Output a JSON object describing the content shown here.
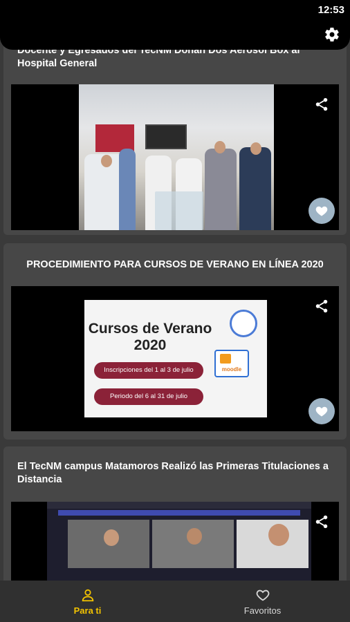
{
  "status_bar": {
    "time": "12:53"
  },
  "top_bar": {
    "settings_icon": "gear-icon"
  },
  "feed": {
    "items": [
      {
        "title": "Docente y Egresados del TecNM Donan Dos Aerosol Box al Hospital General",
        "share_icon": "share-icon",
        "favorite_icon": "heart-icon"
      },
      {
        "title": "PROCEDIMIENTO PARA CURSOS DE VERANO EN LÍNEA 2020",
        "poster": {
          "title_line1": "Cursos de Verano",
          "title_line2": "2020",
          "pill1": "Inscripciones del 1 al 3 de julio",
          "pill2": "Periodo del 6 al 31 de julio",
          "logo_text": "moodle"
        },
        "share_icon": "share-icon",
        "favorite_icon": "heart-icon"
      },
      {
        "title": "El TecNM campus Matamoros Realizó las Primeras Titulaciones a Distancia",
        "share_icon": "share-icon"
      }
    ]
  },
  "bottom_nav": {
    "items": [
      {
        "label": "Para ti",
        "icon": "person-icon",
        "active": true
      },
      {
        "label": "Favoritos",
        "icon": "heart-outline-icon",
        "active": false
      }
    ],
    "accent_color": "#f3c300"
  }
}
